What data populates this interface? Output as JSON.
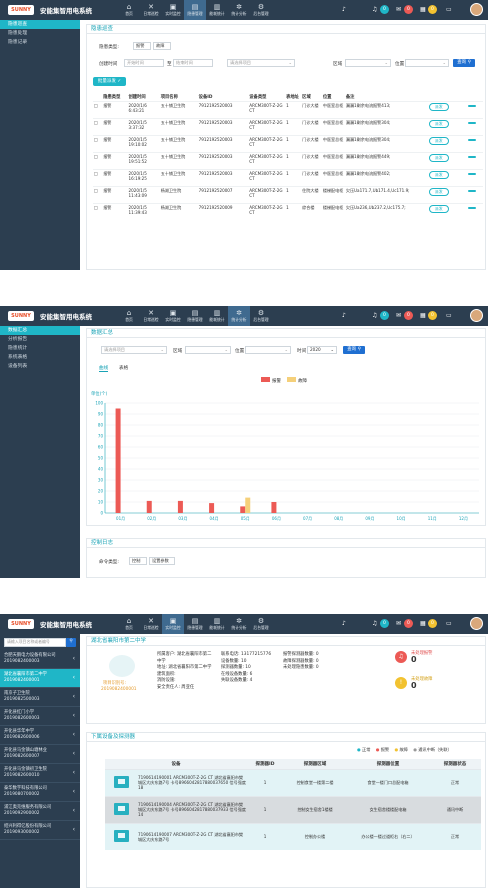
{
  "app": {
    "title": "安能集智用电系统",
    "logo_text": "SUNNY",
    "nav": [
      "首页",
      "日常巡检",
      "实时监控",
      "隐患管理",
      "能耗统计",
      "统计分析",
      "后台管理"
    ],
    "badges": [
      "0",
      "0",
      "0"
    ]
  },
  "s1": {
    "nav_active": 3,
    "sidebar": [
      "隐患巡查",
      "隐患处理",
      "隐患记录"
    ],
    "card_title": "隐患巡查",
    "type_label": "隐患类型:",
    "type_opts": [
      "报警",
      "故障"
    ],
    "time_label": "创建时间",
    "start_ph": "开始时间",
    "to": "至",
    "end_ph": "结束时间",
    "project_ph": "请选择项目",
    "area_label": "区域",
    "pos_label": "位置",
    "query": "查询",
    "batch": "批量派发",
    "columns": [
      "隐患类型",
      "创建时间",
      "项目名称",
      "设备ID",
      "设备类型",
      "表地址",
      "区域",
      "位置",
      "备注"
    ],
    "rows": [
      [
        "报警",
        "2020/1/6 6:43:21",
        "五十铺卫生院",
        "7912192520003",
        "ARCM300T-Z-2G CT",
        "1",
        "门诊大楼",
        "中医室总柜",
        "漏漏1剩余电流报警413;"
      ],
      [
        "报警",
        "2020/1/5 3:37:32",
        "五十铺卫生院",
        "7912192520003",
        "ARCM300T-Z-2G CT",
        "1",
        "门诊大楼",
        "中医室总柜",
        "漏漏1剩余电流报警304;"
      ],
      [
        "报警",
        "2020/1/5 19:10:02",
        "五十铺卫生院",
        "7912192520003",
        "ARCM300T-Z-2G CT",
        "1",
        "门诊大楼",
        "中医室总柜",
        "漏漏1剩余电流报警304;"
      ],
      [
        "报警",
        "2020/1/5 19:51:52",
        "五十铺卫生院",
        "7912192520003",
        "ARCM300T-Z-2G CT",
        "1",
        "门诊大楼",
        "中医室总柜",
        "漏漏1剩余电流报警449;"
      ],
      [
        "报警",
        "2020/1/5 16:19:25",
        "五十铺卫生院",
        "7912192520003",
        "ARCM300T-Z-2G CT",
        "1",
        "门诊大楼",
        "中医室总柜",
        "漏漏1剩余电流报警402;"
      ],
      [
        "报警",
        "2020/1/5 11:43:09",
        "杨湖卫生院",
        "7912192520007",
        "ARCM300T-Z-2G CT",
        "1",
        "住院大楼",
        "楼梯配电柜",
        "欠压Ua171.7,Ub171.4,Uc171.9;"
      ],
      [
        "报警",
        "2020/1/5 11:39:43",
        "杨湖卫生院",
        "7912192520009",
        "ARCM300T-Z-2G CT",
        "1",
        "综合楼",
        "楼梯配电柜",
        "欠压Ua236,Ub237.2,Uc175.7;"
      ]
    ],
    "op": "派发"
  },
  "s2": {
    "nav_active": 5,
    "sidebar": [
      "数据汇总",
      "分析报告",
      "隐患统计",
      "系统表格",
      "设备列表"
    ],
    "card_title": "数据汇总",
    "project_ph": "请选择项目",
    "area_label": "区域",
    "pos_label": "位置",
    "time_label": "时间",
    "year": "2020",
    "query": "查询",
    "tabs": [
      "曲线",
      "表格"
    ],
    "ctrl_title": "控制日志",
    "ctrl_label": "命令类型:",
    "ctrl_opts": [
      "控制",
      "设置参数"
    ]
  },
  "s3": {
    "nav_active": 2,
    "search_ph": "请输入项目名称或者编号",
    "tree": [
      [
        "合肥天鹅电力设备有限公司",
        "2019082400003"
      ],
      [
        "湖北省襄阳市第二中学",
        "2019082400001"
      ],
      [
        "南京子卫生院",
        "2019082500003"
      ],
      [
        "开化县红门小学",
        "2019082600003"
      ],
      [
        "开化县华年中学",
        "2019082600006"
      ],
      [
        "开化县马金镇山塘林业",
        "2019082600007"
      ],
      [
        "开化县马金镇初卫生院",
        "2019082600010"
      ],
      [
        "泰华数字科技有限公司",
        "2019080700002"
      ],
      [
        "浦江奥克维服务有限公司",
        "2019092900002"
      ],
      [
        "绍兴利得亿股份有限公司",
        "2019093000002"
      ]
    ],
    "tree_active": 1,
    "card_title": "湖北省襄阳市第二中学",
    "proj_label": "项目识别号:",
    "proj_id": "2019082400001",
    "info_a": [
      "所属客户: 湖北省襄阳市第二中学",
      "地址: 湖北省襄阳市第二中学",
      "建筑面积:",
      "消防设施:",
      "安全责任人: 周亚任"
    ],
    "info_b": [
      "联系电话: 13177215776",
      "设备数量: 10",
      "探测器数量: 10",
      "在线设备数量: 6",
      "失联设备数量: 4"
    ],
    "info_c": [
      "报警探测器数量: 0",
      "故障探测器数量: 0",
      "未处理隐患数量: 0"
    ],
    "alarm_label": "未处理报警",
    "alarm_val": "0",
    "fault_label": "未处理故障",
    "fault_val": "0",
    "sec_title": "下属设备及探测器",
    "legend": [
      "正常",
      "报警",
      "故障",
      "通讯中断（失联）"
    ],
    "gt_cols": [
      "设备",
      "探测器ID",
      "探测器区域",
      "探测器位置",
      "探测器状态"
    ],
    "gt_rows": [
      [
        "7190614190001 ARCM300T-Z-2G CT 湖北省襄阳市樊城区大庆东路7号 卡号8966042817880037650 信号强度18",
        "1",
        "控制食堂一楼第二楼",
        "食堂一楼门口总配电箱",
        "正常"
      ],
      [
        "7190614190004 ARCM300T-Z-2G CT 湖北省襄阳市樊城区大庆东路7号 卡号8966042817880037933 信号强度14",
        "1",
        "控制女生宿舍1楼楼",
        "女生宿舍楼楼配电箱",
        "通讯中断"
      ],
      [
        "7190614190007 ARCM300T-Z-2G CT 湖北省襄阳市樊城区大庆东路7号",
        "1",
        "控制办公楼",
        "办公楼一楼过道柜右（右二）",
        "正常"
      ]
    ]
  },
  "chart_data": {
    "type": "bar",
    "ylabel": "单位(个)",
    "categories": [
      "01月",
      "02月",
      "03月",
      "04月",
      "05月",
      "06月",
      "07月",
      "08月",
      "09月",
      "10月",
      "11月",
      "12月"
    ],
    "ylim": [
      0,
      100
    ],
    "yticks": [
      0,
      10,
      20,
      30,
      40,
      50,
      60,
      70,
      80,
      90,
      100
    ],
    "series": [
      {
        "name": "报警",
        "color": "#ec5a55",
        "values": [
          95,
          11,
          11,
          9,
          6,
          10,
          0,
          0,
          0,
          0,
          0,
          0
        ]
      },
      {
        "name": "故障",
        "color": "#f5d07a",
        "values": [
          0,
          0,
          0,
          0,
          14,
          0,
          0,
          0,
          0,
          0,
          0,
          0
        ]
      }
    ]
  }
}
